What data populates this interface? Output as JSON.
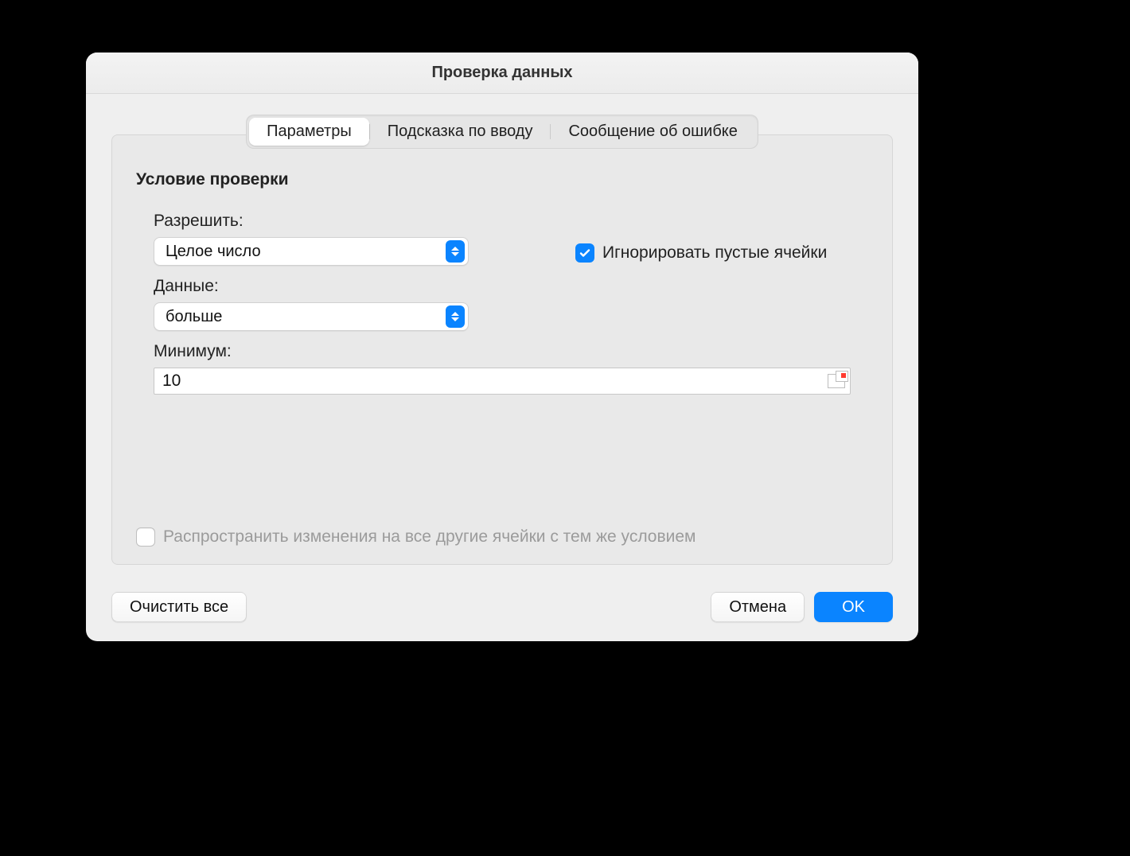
{
  "window": {
    "title": "Проверка данных"
  },
  "tabs": {
    "parameters": "Параметры",
    "input_hint": "Подсказка по вводу",
    "error_message": "Сообщение об ошибке",
    "active": "parameters"
  },
  "section": {
    "heading": "Условие проверки"
  },
  "allow": {
    "label": "Разрешить:",
    "value": "Целое число"
  },
  "ignore_blank": {
    "label": "Игнорировать пустые ячейки",
    "checked": true
  },
  "data": {
    "label": "Данные:",
    "value": "больше"
  },
  "minimum": {
    "label": "Минимум:",
    "value": "10"
  },
  "propagate": {
    "label": "Распространить изменения на все другие ячейки с тем же условием",
    "checked": false,
    "enabled": false
  },
  "buttons": {
    "clear_all": "Очистить все",
    "cancel": "Отмена",
    "ok": "OK"
  },
  "colors": {
    "accent": "#0a84ff"
  }
}
